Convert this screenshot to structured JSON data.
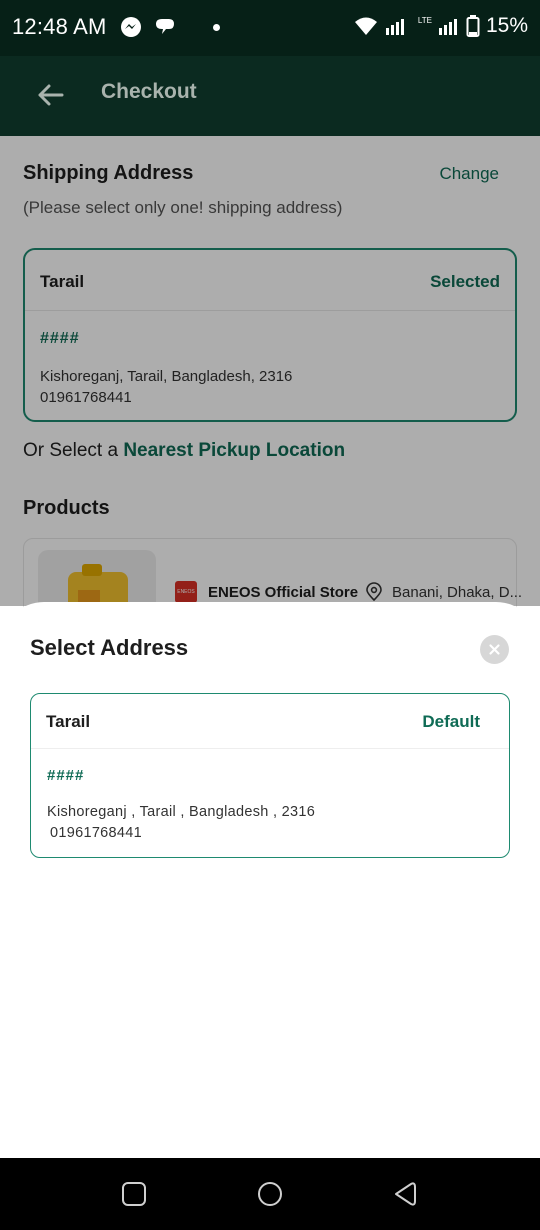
{
  "status_bar": {
    "time": "12:48 AM",
    "network_label": "LTE",
    "battery_percent": "15%",
    "icons": [
      "messenger-icon",
      "chat-bubble-icon",
      "notification-dot-icon",
      "wifi-icon",
      "signal-icon",
      "battery-icon"
    ]
  },
  "app_bar": {
    "title": "Checkout",
    "back_icon": "arrow-left-icon"
  },
  "shipping": {
    "title": "Shipping Address",
    "change_label": "Change",
    "subtitle": "(Please select only one! shipping address)",
    "selected_address": {
      "name": "Tarail",
      "state": "Selected",
      "house": "####",
      "line1": "Kishoreganj, Tarail, Bangladesh, 2316",
      "line2": "01961768441"
    },
    "pickup_prefix": "Or Select a",
    "pickup_link": "Nearest Pickup Location"
  },
  "products": {
    "title": "Products",
    "store_logo_text": "ENEOS",
    "store_name": "ENEOS Official Store",
    "store_location": "Banani, Dhaka, D..."
  },
  "sheet": {
    "title": "Select Address",
    "close_icon": "close-icon",
    "address": {
      "name": "Tarail",
      "state": "Default",
      "house": "####",
      "line1": "Kishoreganj , Tarail , Bangladesh , 2316",
      "line2": "01961768441"
    }
  },
  "nav_bar": {
    "icons": [
      "recents-square-icon",
      "home-circle-icon",
      "back-triangle-icon"
    ]
  },
  "colors": {
    "primary_dark": "#0b2a20",
    "accent_green": "#0f6b55",
    "border_green": "#1e8a70"
  }
}
